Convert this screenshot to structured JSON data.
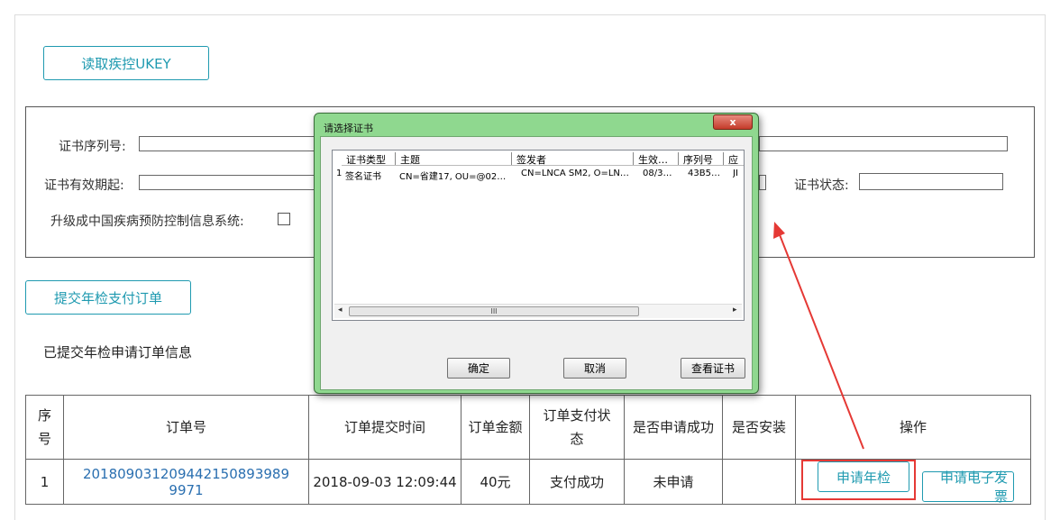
{
  "read_ukey_label": "读取疾控UKEY",
  "cert_form": {
    "serial_label": "证书序列号:",
    "valid_from_label": "证书有效期起:",
    "status_label": "证书状态:",
    "upgrade_label": "升级成中国疾病预防控制信息系统:"
  },
  "submit_label": "提交年检支付订单",
  "section_title": "已提交年检申请订单信息",
  "table": {
    "headers": [
      "序\n号",
      "订单号",
      "订单提交时间",
      "订单金额",
      "订单支付状\n态",
      "是否申请成功",
      "是否安装",
      "操作"
    ],
    "rows": [
      {
        "index": "1",
        "order_no": "20180903120944215089398 99971",
        "order_no_full": "201809031209442150893989 9971",
        "time": "2018-09-03 12:09:44",
        "amount": "40元",
        "pay_status": "支付成功",
        "apply_success": "未申请",
        "installed": "",
        "op_annual": "申请年检",
        "op_invoice": "申请电子发票"
      }
    ]
  },
  "dialog": {
    "title": "请选择证书",
    "close_glyph": "x",
    "columns": [
      "证书类型",
      "主题",
      "签发者",
      "生效…",
      "序列号",
      "应"
    ],
    "rows": [
      {
        "index": "1",
        "type": "签名证书",
        "subject": "CN=省建17, OU=@02…",
        "issuer": "CN=LNCA SM2, O=LN…",
        "valid": "08/3…",
        "serial": "43B5…",
        "extra": "JI"
      }
    ],
    "scroll_grip": "III",
    "ok_label": "确定",
    "cancel_label": "取消",
    "view_label": "查看证书"
  },
  "colors": {
    "accent": "#1f9ab0",
    "link": "#2a6fb0",
    "highlight": "#e53935",
    "dialog_frame": "#8fd88f"
  }
}
